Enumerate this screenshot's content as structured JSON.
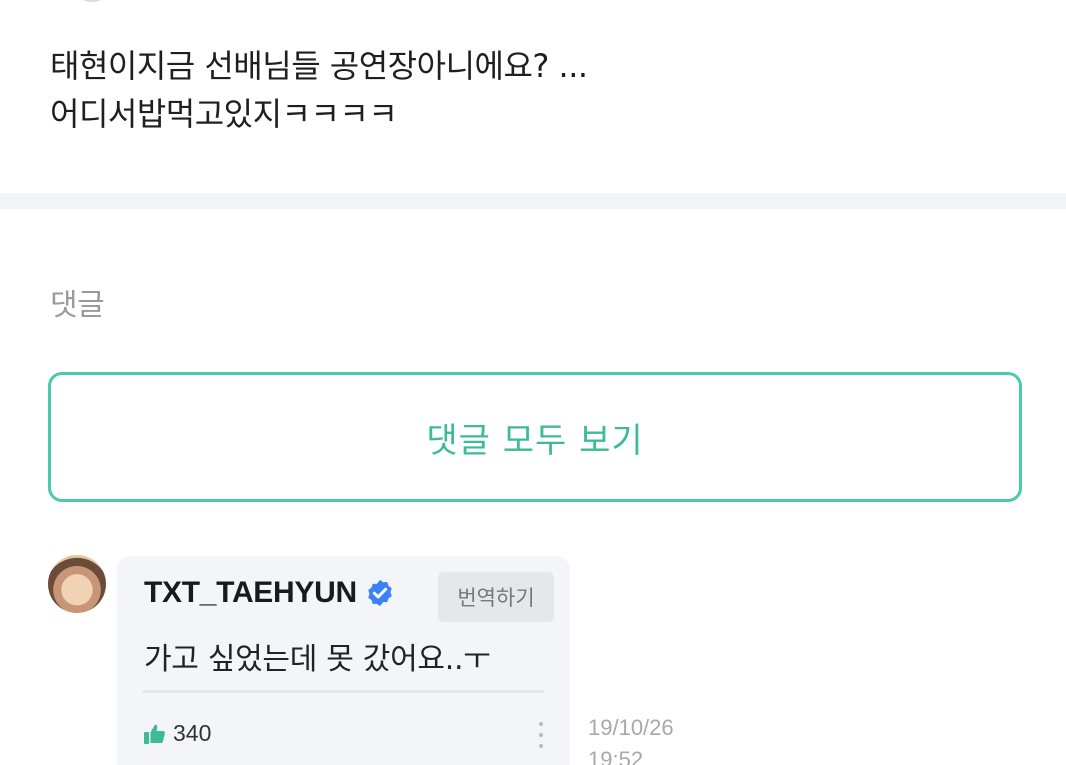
{
  "post": {
    "body_lines": [
      "태현이지금 선배님들 공연장아니에요? ...",
      "어디서밥먹고있지ㅋㅋㅋㅋ"
    ]
  },
  "comments": {
    "heading": "댓글",
    "view_all_label": "댓글 모두 보기",
    "items": [
      {
        "author": "TXT_TAEHYUN",
        "verified_icon": "verified-badge-icon",
        "translate_label": "번역하기",
        "text": "가고 싶었는데 못 갔어요..ㅜ",
        "likes": "340",
        "date": "19/10/26",
        "time": "19:52"
      }
    ]
  },
  "colors": {
    "accent": "#3dbb97",
    "verified": "#3b82f6",
    "like": "#3dbb97"
  }
}
